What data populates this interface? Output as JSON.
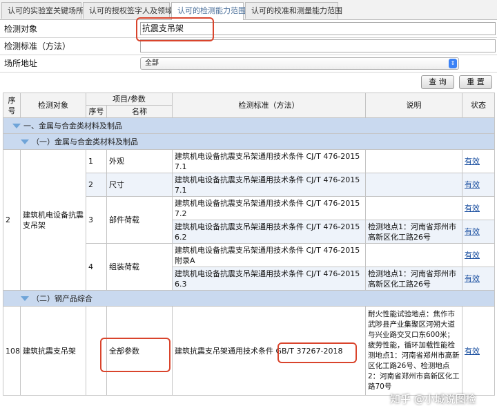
{
  "tabs": [
    "认可的实验室关键场所",
    "认可的授权签字人及领域",
    "认可的检测能力范围",
    "认可的校准和测量能力范围"
  ],
  "form": {
    "object_label": "检测对象",
    "object_value": "抗震支吊架",
    "standard_label": "检测标准（方法）",
    "standard_value": "",
    "site_label": "场所地址",
    "site_value": "全部"
  },
  "buttons": {
    "query": "查 询",
    "reset": "重 置"
  },
  "table": {
    "h_no": "序号",
    "h_object": "检测对象",
    "h_item": "项目/参数",
    "h_sub_no": "序号",
    "h_name": "名称",
    "h_standard": "检测标准（方法）",
    "h_note": "说明",
    "h_status": "状态",
    "cat1": "一、金属与合金类材料及制品",
    "sub1": "（一）金属与合金类材料及制品",
    "r2_no": "2",
    "r2_object": "建筑机电设备抗震支吊架",
    "i1_no": "1",
    "i1_name": "外观",
    "i1_std": "建筑机电设备抗震支吊架通用技术条件 CJ/T 476-2015 7.1",
    "i2_no": "2",
    "i2_name": "尺寸",
    "i2_std": "建筑机电设备抗震支吊架通用技术条件 CJ/T 476-2015 7.1",
    "i3_no": "3",
    "i3_name": "部件荷载",
    "i3_std_a": "建筑机电设备抗震支吊架通用技术条件 CJ/T 476-2015 7.2",
    "i3_std_b": "建筑机电设备抗震支吊架通用技术条件 CJ/T 476-2015 6.2",
    "i3_note_b": "检测地点1：河南省郑州市高新区化工路26号",
    "i4_no": "4",
    "i4_name": "组装荷载",
    "i4_std_a": "建筑机电设备抗震支吊架通用技术条件 CJ/T 476-2015 附录A",
    "i4_std_b": "建筑机电设备抗震支吊架通用技术条件 CJ/T 476-2015 6.3",
    "i4_note_b": "检测地点1：河南省郑州市高新区化工路26号",
    "sub2": "（二）钢产品综合",
    "r108_no": "108",
    "r108_object": "建筑抗震支吊架",
    "r108_name": "全部参数",
    "r108_std": "建筑抗震支吊架通用技术条件",
    "r108_code": "GB/T 37267-2018",
    "r108_note": "耐火性能试验地点：焦作市武陟县产业集聚区河朔大道与兴业路交叉口东600米；疲劳性能，循环加载性能检测地点1：河南省郑州市高新区化工路26号、检测地点2：河南省郑州市高新区化工路70号",
    "status": "有效"
  },
  "watermark": "知乎 @小城说图检"
}
